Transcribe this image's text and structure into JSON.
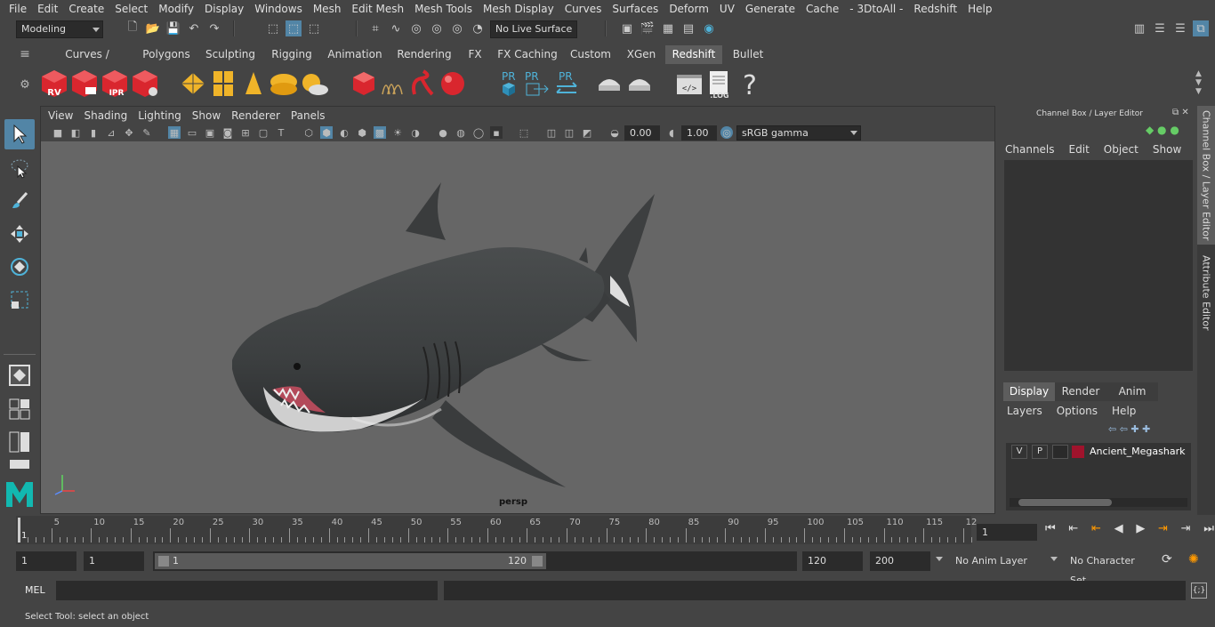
{
  "menus": [
    "File",
    "Edit",
    "Create",
    "Select",
    "Modify",
    "Display",
    "Windows",
    "Mesh",
    "Edit Mesh",
    "Mesh Tools",
    "Mesh Display",
    "Curves",
    "Surfaces",
    "Deform",
    "UV",
    "Generate",
    "Cache",
    "- 3DtoAll -",
    "Redshift",
    "Help"
  ],
  "status": {
    "mode": "Modeling",
    "live_surface": "No Live Surface"
  },
  "shelf_tabs": [
    "Curves / Surfaces",
    "Polygons",
    "Sculpting",
    "Rigging",
    "Animation",
    "Rendering",
    "FX",
    "FX Caching",
    "Custom",
    "XGen",
    "Redshift",
    "Bullet"
  ],
  "shelf_labels": {
    "rv": "RV",
    "ipr": "IPR",
    "pr": "PR",
    "log": ".LOG",
    "help": "?"
  },
  "viewport": {
    "menus": [
      "View",
      "Shading",
      "Lighting",
      "Show",
      "Renderer",
      "Panels"
    ],
    "exposure": "0.00",
    "gamma": "1.00",
    "color_space": "sRGB gamma",
    "camera": "persp"
  },
  "channel_box": {
    "title": "Channel Box / Layer Editor",
    "menus": [
      "Channels",
      "Edit",
      "Object",
      "Show"
    ],
    "layer_tabs": [
      "Display",
      "Render",
      "Anim"
    ],
    "layer_menus": [
      "Layers",
      "Options",
      "Help"
    ],
    "layer": {
      "v": "V",
      "p": "P",
      "name": "Ancient_Megashark",
      "color": "#a0132c"
    }
  },
  "side_tabs": [
    "Channel Box / Layer Editor",
    "Attribute Editor"
  ],
  "timeline": {
    "ticks": [
      "5",
      "10",
      "15",
      "20",
      "25",
      "30",
      "35",
      "40",
      "45",
      "50",
      "55",
      "60",
      "65",
      "70",
      "75",
      "80",
      "85",
      "90",
      "95",
      "100",
      "105",
      "110",
      "115",
      "12"
    ],
    "start_label": "1",
    "current_frame": "1"
  },
  "range": {
    "start": "1",
    "playback_start": "1",
    "slider_start": "1",
    "slider_end": "120",
    "playback_end": "120",
    "end": "200",
    "anim_layer": "No Anim Layer",
    "character_set": "No Character Set"
  },
  "command": {
    "label": "MEL"
  },
  "help_line": "Select Tool: select an object",
  "colors": {
    "accent": "#5285a6",
    "redshift_red": "#d9262e",
    "cube_yellow": "#f0b429"
  }
}
